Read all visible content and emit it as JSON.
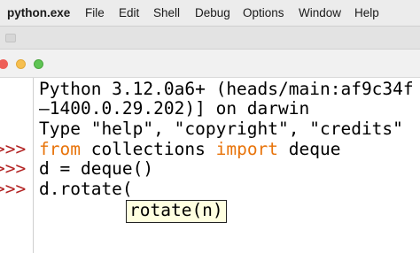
{
  "menubar": {
    "app_name": "python.exe",
    "items": [
      "File",
      "Edit",
      "Shell",
      "Debug",
      "Options",
      "Window",
      "Help"
    ]
  },
  "shell": {
    "banner_lines": [
      "Python 3.12.0a6+ (heads/main:af9c34f",
      "—1400.0.29.202)] on darwin",
      "Type \"help\", \"copyright\", \"credits\""
    ],
    "prompt": ">>>",
    "cmd1_kw1": "from",
    "cmd1_mid": " collections ",
    "cmd1_kw2": "import",
    "cmd1_end": " deque",
    "cmd2": "d = deque()",
    "cmd3": "d.rotate("
  },
  "calltip": {
    "text": "rotate(n)"
  },
  "colors": {
    "prompt": "#b22222",
    "keyword": "#e8740b",
    "calltip_bg": "#ffffe0",
    "close": "#ee5f58",
    "minimize": "#f6bf4f",
    "zoom": "#5fc454"
  }
}
